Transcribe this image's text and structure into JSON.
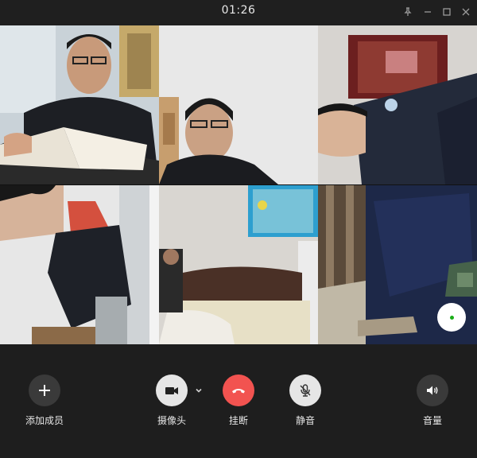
{
  "call": {
    "duration": "01:26"
  },
  "window_controls": {
    "pin": "pin-icon",
    "minimize": "minimize-icon",
    "maximize": "maximize-icon",
    "close": "close-icon"
  },
  "participants": [
    {
      "position": 1,
      "scene": "student-with-book"
    },
    {
      "position": 2,
      "scene": "student-with-glasses"
    },
    {
      "position": 3,
      "scene": "student-rotated"
    },
    {
      "position": 4,
      "scene": "student-rotated-2"
    },
    {
      "position": 5,
      "scene": "bedroom"
    },
    {
      "position": 6,
      "scene": "striped-jacket"
    }
  ],
  "controls": {
    "add_member": {
      "label": "添加成员",
      "icon": "plus-icon"
    },
    "camera": {
      "label": "摄像头",
      "icon": "camera-icon",
      "menu_icon": "chevron-down-icon"
    },
    "hangup": {
      "label": "挂断",
      "icon": "phone-hangup-icon",
      "color": "#f25350"
    },
    "mute": {
      "label": "静音",
      "icon": "mic-off-icon"
    },
    "volume": {
      "label": "音量",
      "icon": "speaker-icon"
    }
  },
  "accent": {
    "status_green": "#1aad19"
  }
}
